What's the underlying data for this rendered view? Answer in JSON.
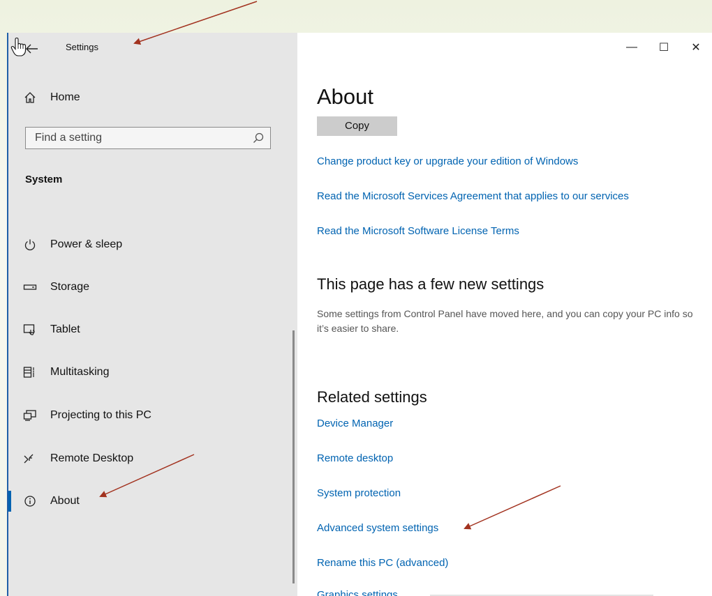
{
  "window": {
    "title": "Settings",
    "controls": {
      "minimize": "—",
      "maximize": "☐",
      "close": "✕"
    }
  },
  "sidebar": {
    "home_label": "Home",
    "search": {
      "placeholder": "Find a setting",
      "value": ""
    },
    "section": "System",
    "items": [
      {
        "label": "Power & sleep",
        "icon": "power-icon"
      },
      {
        "label": "Storage",
        "icon": "storage-icon"
      },
      {
        "label": "Tablet",
        "icon": "tablet-icon"
      },
      {
        "label": "Multitasking",
        "icon": "multitasking-icon"
      },
      {
        "label": "Projecting to this PC",
        "icon": "projecting-icon"
      },
      {
        "label": "Remote Desktop",
        "icon": "remote-desktop-icon"
      },
      {
        "label": "About",
        "icon": "info-icon",
        "selected": true
      }
    ]
  },
  "content": {
    "page_title": "About",
    "copy_button": "Copy",
    "links": [
      "Change product key or upgrade your edition of Windows",
      "Read the Microsoft Services Agreement that applies to our services",
      "Read the Microsoft Software License Terms"
    ],
    "new_settings": {
      "heading": "This page has a few new settings",
      "description": "Some settings from Control Panel have moved here, and you can copy your PC info so it’s easier to share."
    },
    "related": {
      "heading": "Related settings",
      "links": [
        "Device Manager",
        "Remote desktop",
        "System protection",
        "Advanced system settings",
        "Rename this PC (advanced)"
      ],
      "clipped_link": "Graphics settings"
    }
  },
  "colors": {
    "accent": "#0063b1",
    "sidebar_bg": "#e6e6e6",
    "annotation_arrow": "#a2321f"
  }
}
